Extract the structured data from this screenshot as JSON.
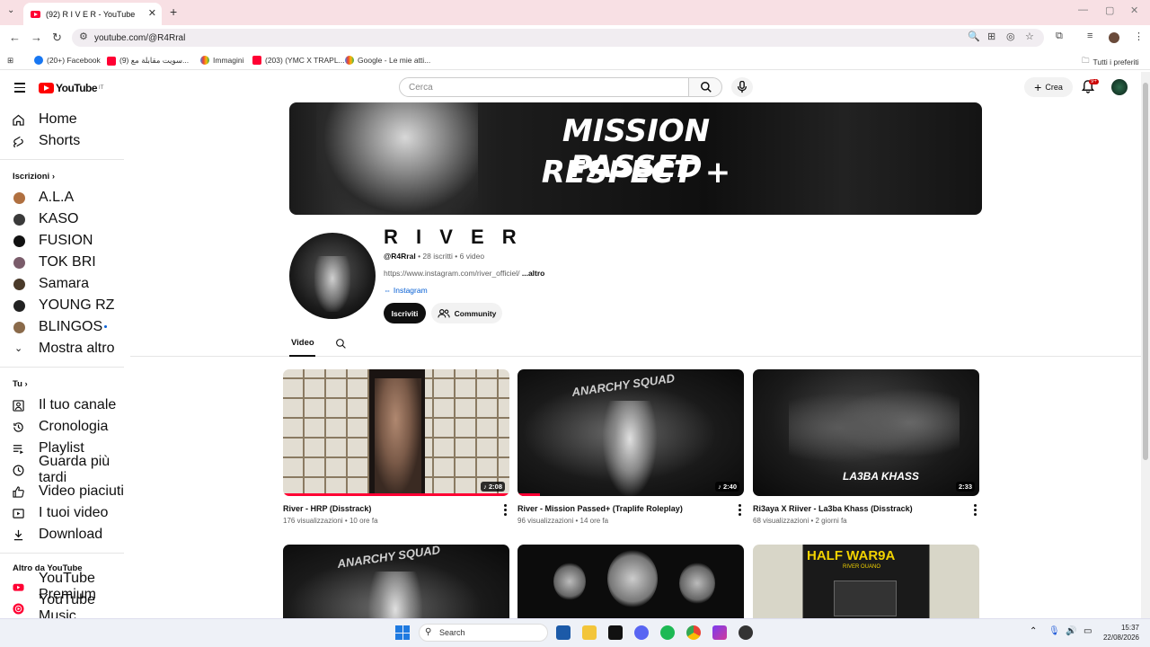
{
  "browser": {
    "tab_title": "(92) R I V E R - YouTube",
    "url": "youtube.com/@R4Rral",
    "bookmarks": [
      "(20+) Facebook",
      "(9) سويت مقابلة مع...",
      "Immagini",
      "(203) (YMC X TRAPL...",
      "Google - Le mie atti..."
    ],
    "all_bookmarks": "Tutti i preferiti"
  },
  "header": {
    "logo_text": "YouTube",
    "logo_country": "IT",
    "search_placeholder": "Cerca",
    "create_label": "Crea",
    "notif_count": "9+"
  },
  "sidebar": {
    "top": [
      {
        "label": "Home",
        "icon": "home-icon"
      },
      {
        "label": "Shorts",
        "icon": "shorts-icon"
      }
    ],
    "subs_title": "Iscrizioni",
    "subs": [
      {
        "label": "A.L.A",
        "color": "#b07040"
      },
      {
        "label": "KASO",
        "color": "#3a3a3a"
      },
      {
        "label": "FUSION",
        "color": "#111111"
      },
      {
        "label": "TOK BRI",
        "color": "#7a5c6a"
      },
      {
        "label": "Samara",
        "color": "#4a3a2a"
      },
      {
        "label": "YOUNG RZ",
        "color": "#222222"
      },
      {
        "label": "BLINGOS",
        "color": "#8a6a4a"
      }
    ],
    "show_more": "Mostra altro",
    "you_title": "Tu",
    "you": [
      {
        "label": "Il tuo canale",
        "icon": "channel-icon"
      },
      {
        "label": "Cronologia",
        "icon": "history-icon"
      },
      {
        "label": "Playlist",
        "icon": "playlist-icon"
      },
      {
        "label": "Guarda più tardi",
        "icon": "watch-later-icon"
      },
      {
        "label": "Video piaciuti",
        "icon": "like-icon"
      },
      {
        "label": "I tuoi video",
        "icon": "your-videos-icon"
      },
      {
        "label": "Download",
        "icon": "download-icon"
      }
    ],
    "more_title": "Altro da YouTube",
    "more": [
      {
        "label": "YouTube Premium"
      },
      {
        "label": "YouTube Music"
      }
    ]
  },
  "banner": {
    "line1": "MISSION PASSED",
    "line2": "RESPECT +"
  },
  "channel": {
    "name": "R I V E R",
    "handle": "@R4Rral",
    "meta": " • 28 iscritti • 6 video",
    "desc": "https://www.instagram.com/river_officiel/",
    "desc_more": "...altro",
    "link": "Instagram",
    "subscribe": "Iscriviti",
    "community": "Community"
  },
  "tabs": {
    "video": "Video"
  },
  "videos": [
    {
      "title": "River - HRP (Disstrack)",
      "meta": "176 visualizzazioni • 10 ore fa",
      "duration": "2:08",
      "progress": 1.0
    },
    {
      "title": "River - Mission Passed+ (Traplife Roleplay)",
      "meta": "96 visualizzazioni • 14 ore fa",
      "duration": "2:40",
      "progress": 0.1
    },
    {
      "title": "Ri3aya X Riiver - La3ba Khass (Disstrack)",
      "meta": "68 visualizzazioni • 2 giorni fa",
      "duration": "2:33",
      "progress": 0
    },
    {
      "title": "",
      "meta": "",
      "duration": "",
      "progress": 0
    },
    {
      "title": "",
      "meta": "",
      "duration": "",
      "progress": 0
    },
    {
      "title": "",
      "meta": "",
      "duration": "",
      "progress": 0
    }
  ],
  "thumb_text": {
    "anarchy": "ANARCHY SQUAD",
    "laaba": "LA3BA KHASS",
    "half_title": "HALF WAR9A",
    "half_sub": "RIVER OUANO"
  },
  "taskbar": {
    "search": "Search",
    "time": "15:37",
    "date": "22/08/2026"
  }
}
